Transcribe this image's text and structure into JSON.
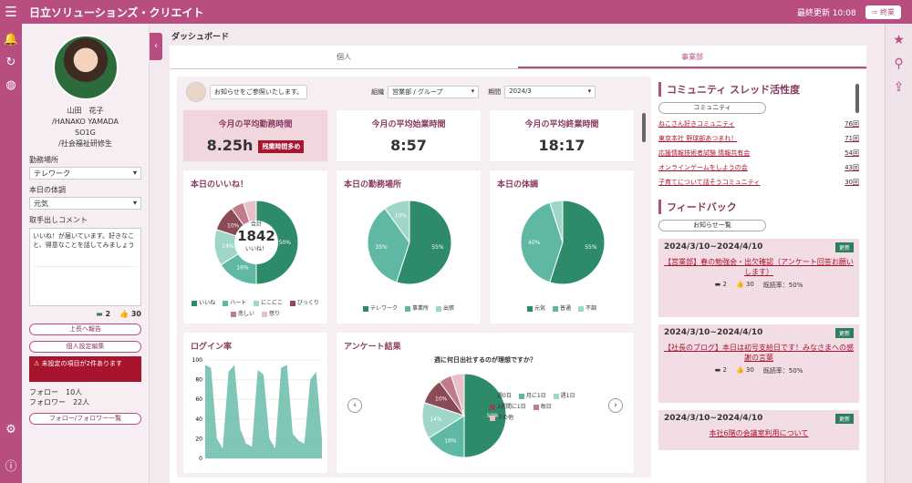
{
  "header": {
    "menu_icon": "menu-icon",
    "title": "日立ソリューションズ・クリエイト",
    "last_login": "最終更新 10:08",
    "logout": "終業"
  },
  "profile": {
    "name": "山田　花子",
    "name_en": "/HANAKO YAMADA",
    "dept": "SO1G",
    "role": "/社会福祉研修生",
    "work_place_label": "勤務場所",
    "work_place_value": "テレワーク",
    "condition_label": "本日の体調",
    "condition_value": "元気",
    "comment_label": "取手出しコメント",
    "comment_text": "いいね！が届いています。好きなこと、得意なことを話してみましょう",
    "comments_count": "2",
    "likes_count": "30",
    "btn_above": "上長へ報告",
    "btn_edit": "個人設定編集",
    "alert": "未設定の項目が2件あります",
    "follow_label": "フォロー",
    "follow_count": "10人",
    "follower_label": "フォロワー",
    "follower_count": "22人",
    "follow_list": "フォロー/フォロワー一覧"
  },
  "dashboard": {
    "title": "ダッシュボード",
    "tabs": [
      "個人",
      "事業部"
    ],
    "greeting": "お知らせをご参照いたします。",
    "filter1_label": "組織",
    "filter1_value": "営業部 / グループ",
    "filter2_label": "期間",
    "filter2_value": "2024/3",
    "kpis": [
      {
        "title": "今月の平均勤務時間",
        "value": "8.25h",
        "badge": "残業時間多め"
      },
      {
        "title": "今月の平均始業時間",
        "value": "8:57"
      },
      {
        "title": "今月の平均終業時間",
        "value": "18:17"
      }
    ],
    "likes": {
      "title": "本日のいいね！",
      "total_label": "合計",
      "total": "1842",
      "unit": "いいね！",
      "legend": [
        "いいね",
        "ハート",
        "にこにこ",
        "びっくり",
        "悲しい",
        "怒り"
      ]
    },
    "workplace": {
      "title": "本日の勤務場所",
      "legend": [
        "テレワーク",
        "事業所",
        "出張"
      ]
    },
    "health": {
      "title": "本日の体調",
      "legend": [
        "元気",
        "普通",
        "不調"
      ]
    },
    "login": {
      "title": "ログイン率",
      "yticks": [
        "100",
        "80",
        "60",
        "40",
        "20",
        "0"
      ]
    },
    "survey": {
      "title": "アンケート結果",
      "question": "週に何日出社するのが理想ですか？",
      "legend": [
        "週0日",
        "月に1日",
        "週1日",
        "3週間に1日",
        "毎日",
        "その他"
      ]
    }
  },
  "community": {
    "title": "コミュニティ スレッド活性度",
    "button": "コミュニティ",
    "items": [
      {
        "name": "ねこさん好きコミュニティ",
        "count": "76回"
      },
      {
        "name": "東京本社 野球部あつまれ！",
        "count": "71回"
      },
      {
        "name": "応援情報技術者試験 情報共有会",
        "count": "54回"
      },
      {
        "name": "オンラインゲームをしようの会",
        "count": "43回"
      },
      {
        "name": "子育てについて話そうコミュニティ",
        "count": "30回"
      }
    ]
  },
  "feedback": {
    "title": "フィードバック",
    "button": "お知らせ一覧",
    "new_label": "更新",
    "items": [
      {
        "date": "2024/3/10~2024/4/10",
        "text": "【営業部】春の勉強会・出欠確認（アンケート回答お願いします）",
        "comments": "2",
        "likes": "30",
        "rate": "既読率：50%"
      },
      {
        "date": "2024/3/10~2024/4/10",
        "text": "【社長のブログ】本日は初号支給日です！みなさまへの感謝の言葉",
        "comments": "2",
        "likes": "30",
        "rate": "既読率：50%"
      },
      {
        "date": "2024/3/10~2024/4/10",
        "text": "本社6階の会議室利用について"
      }
    ]
  },
  "chart_data": [
    {
      "type": "pie",
      "title": "本日のいいね！",
      "categories": [
        "いいね",
        "ハート",
        "にこにこ",
        "びっくり",
        "悲しい",
        "怒り"
      ],
      "values": [
        50,
        16,
        14,
        10,
        5,
        5
      ]
    },
    {
      "type": "pie",
      "title": "本日の勤務場所",
      "categories": [
        "テレワーク",
        "事業所",
        "出張"
      ],
      "values": [
        55,
        35,
        10
      ]
    },
    {
      "type": "pie",
      "title": "本日の体調",
      "categories": [
        "元気",
        "普通",
        "不調"
      ],
      "values": [
        55,
        40,
        5
      ]
    },
    {
      "type": "area",
      "title": "ログイン率",
      "ylim": [
        0,
        100
      ],
      "values": [
        95,
        92,
        20,
        10,
        88,
        95,
        30,
        15,
        12,
        90,
        85,
        20,
        10,
        92,
        95,
        25,
        18,
        15,
        80,
        88,
        20
      ]
    },
    {
      "type": "pie",
      "title": "アンケート結果",
      "categories": [
        "週0日",
        "月に1日",
        "週1日",
        "3週間に1日",
        "毎日",
        "その他"
      ],
      "values": [
        50,
        16,
        14,
        10,
        5,
        5
      ]
    }
  ],
  "colors": {
    "brand": "#b84d80",
    "green_dark": "#2e8b6a",
    "green_mid": "#5fb8a4",
    "green_light": "#9fd6c7",
    "maroon": "#8a4a56",
    "pink": "#c07c8a",
    "pink_light": "#e9c0c8"
  }
}
